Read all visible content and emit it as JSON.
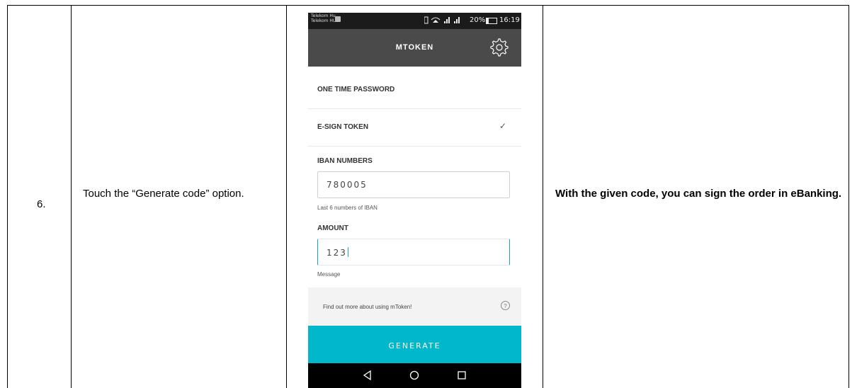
{
  "row": {
    "step_number": "6.",
    "instruction": "Touch the “Generate code” option.",
    "result": "With the given code, you can sign the order in eBanking."
  },
  "phone": {
    "status_bar": {
      "carrier_line1": "Telekom Hu...",
      "carrier_line2": "Telekom HU",
      "signal_icons": "📳 ▼ .∥ .∥",
      "battery_text": "20%",
      "battery_level": 0.2,
      "time": "16:19"
    },
    "app_bar": {
      "title": "MTOKEN",
      "settings_icon": "gear-icon"
    },
    "menu": [
      {
        "label": "ONE TIME PASSWORD",
        "selected": false
      },
      {
        "label": "E-SIGN TOKEN",
        "selected": true,
        "check": "✓"
      }
    ],
    "iban": {
      "label": "IBAN NUMBERS",
      "value": "780005",
      "hint": "Last 6 numbers of IBAN"
    },
    "amount": {
      "label": "AMOUNT",
      "value": "123",
      "hint": "Message"
    },
    "info": {
      "text": "Find out more about using mToken!",
      "help_icon": "?"
    },
    "generate_button": "GENERATE",
    "nav": [
      "back-icon",
      "home-icon",
      "recents-icon"
    ],
    "colors": {
      "app_bar": "#4a4a4a",
      "accent": "#00b7cc",
      "status_bar": "#1b1b1b"
    }
  }
}
